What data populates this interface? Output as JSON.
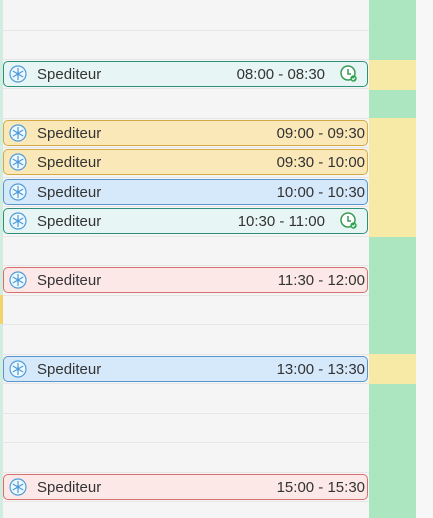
{
  "events": [
    {
      "title": "Spediteur",
      "time": "08:00 - 08:30",
      "status": "check-clock"
    },
    {
      "title": "Spediteur",
      "time": "09:00 - 09:30",
      "status": ""
    },
    {
      "title": "Spediteur",
      "time": "09:30 - 10:00",
      "status": ""
    },
    {
      "title": "Spediteur",
      "time": "10:00 - 10:30",
      "status": ""
    },
    {
      "title": "Spediteur",
      "time": "10:30 - 11:00",
      "status": "check-clock"
    },
    {
      "title": "Spediteur",
      "time": "11:30 - 12:00",
      "status": ""
    },
    {
      "title": "Spediteur",
      "time": "13:00 - 13:30",
      "status": ""
    },
    {
      "title": "Spediteur",
      "time": "15:00 - 15:30",
      "status": ""
    }
  ],
  "icons": {
    "event": "snowflake-gear-icon",
    "status": "clock-check-icon"
  },
  "colors": {
    "teal_bg": "#e7f6f4",
    "yellow_bg": "#fbe8b9",
    "blue_bg": "#d5e9fb",
    "red_bg": "#fde8e8",
    "green_column": "#abe6c1",
    "yellow_column": "#f6eaa6"
  }
}
